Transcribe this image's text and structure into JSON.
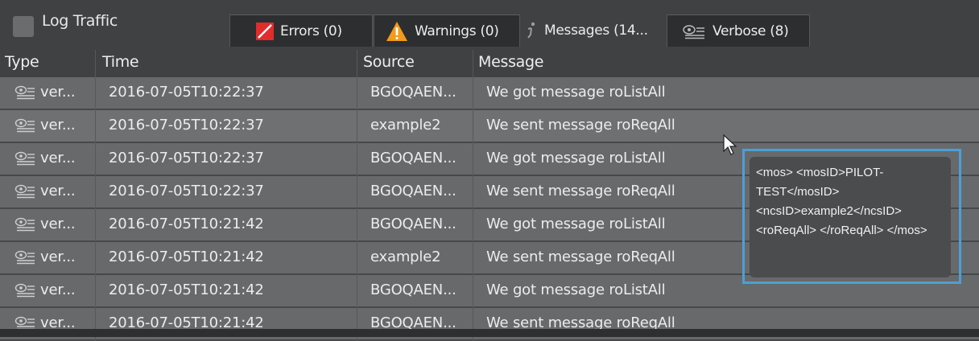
{
  "toolbar": {
    "log_traffic_label": "Log Traffic",
    "filters": [
      {
        "label": "Errors (0)",
        "icon": "error-icon"
      },
      {
        "label": "Warnings (0)",
        "icon": "warning-icon"
      },
      {
        "label": "Messages (14...",
        "icon": "info-icon"
      },
      {
        "label": "Verbose (8)",
        "icon": "verbose-icon"
      }
    ]
  },
  "table": {
    "columns": [
      "Type",
      "Time",
      "Source",
      "Message"
    ],
    "rows": [
      {
        "type": "ver...",
        "time": "2016-07-05T10:22:37",
        "source": "BGOQAEN...",
        "message": "We got message roListAll"
      },
      {
        "type": "ver...",
        "time": "2016-07-05T10:22:37",
        "source": "example2",
        "message": "We sent message roReqAll"
      },
      {
        "type": "ver...",
        "time": "2016-07-05T10:22:37",
        "source": "BGOQAEN...",
        "message": "We got message roListAll"
      },
      {
        "type": "ver...",
        "time": "2016-07-05T10:22:37",
        "source": "BGOQAEN...",
        "message": "We sent message roReqAll"
      },
      {
        "type": "ver...",
        "time": "2016-07-05T10:21:42",
        "source": "BGOQAEN...",
        "message": "We got message roListAll"
      },
      {
        "type": "ver...",
        "time": "2016-07-05T10:21:42",
        "source": "example2",
        "message": "We sent message roReqAll"
      },
      {
        "type": "ver...",
        "time": "2016-07-05T10:21:42",
        "source": "BGOQAEN...",
        "message": "We got message roListAll"
      },
      {
        "type": "ver...",
        "time": "2016-07-05T10:21:42",
        "source": "BGOQAEN...",
        "message": "We sent message roReqAll"
      }
    ]
  },
  "tooltip": {
    "text": "<mos> <mosID>PILOT-TEST</mosID> <ncsID>example2</ncsID> <roReqAll> </roReqAll> </mos>"
  },
  "colors": {
    "background": "#3f4142",
    "row": "#68696b",
    "tooltip_border": "#4aa0d6",
    "error_red": "#e22b2b",
    "warning_orange": "#f39a1c"
  }
}
